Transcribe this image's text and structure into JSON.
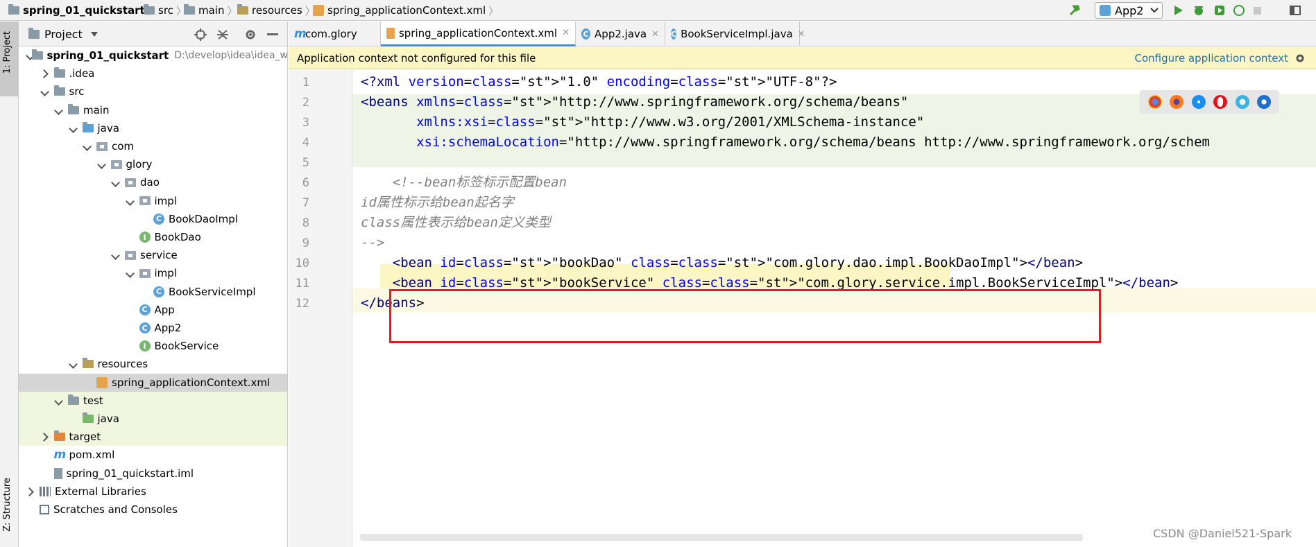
{
  "nav": {
    "breadcrumbs": [
      "spring_01_quickstart",
      "src",
      "main",
      "resources",
      "spring_applicationContext.xml"
    ],
    "run_config": "App2"
  },
  "side": {
    "project_tab": "1: Project",
    "structure_tab": "Z: Structure"
  },
  "project_panel": {
    "title": "Project"
  },
  "tree": [
    {
      "label": "spring_01_quickstart",
      "suffix": "D:\\develop\\idea\\idea_w",
      "icon": "module-folder-icon",
      "arrow": "d",
      "depth": 0
    },
    {
      "label": ".idea",
      "icon": "folder-icon",
      "arrow": "r",
      "depth": 1
    },
    {
      "label": "src",
      "icon": "folder-icon",
      "arrow": "d",
      "depth": 1
    },
    {
      "label": "main",
      "icon": "folder-icon",
      "arrow": "d",
      "depth": 2
    },
    {
      "label": "java",
      "icon": "source-folder-icon",
      "arrow": "d",
      "depth": 3
    },
    {
      "label": "com",
      "icon": "package-icon",
      "arrow": "d",
      "depth": 4
    },
    {
      "label": "glory",
      "icon": "package-icon",
      "arrow": "d",
      "depth": 5
    },
    {
      "label": "dao",
      "icon": "package-icon",
      "arrow": "d",
      "depth": 6
    },
    {
      "label": "impl",
      "icon": "package-icon",
      "arrow": "d",
      "depth": 7
    },
    {
      "label": "BookDaoImpl",
      "icon": "class-icon",
      "arrow": "n",
      "depth": 8
    },
    {
      "label": "BookDao",
      "icon": "interface-icon",
      "arrow": "n",
      "depth": 7
    },
    {
      "label": "service",
      "icon": "package-icon",
      "arrow": "d",
      "depth": 6
    },
    {
      "label": "impl",
      "icon": "package-icon",
      "arrow": "d",
      "depth": 7
    },
    {
      "label": "BookServiceImpl",
      "icon": "class-icon",
      "arrow": "n",
      "depth": 8
    },
    {
      "label": "App",
      "icon": "runnable-class-icon",
      "arrow": "n",
      "depth": 7
    },
    {
      "label": "App2",
      "icon": "runnable-class-icon",
      "arrow": "n",
      "depth": 7
    },
    {
      "label": "BookService",
      "icon": "interface-icon",
      "arrow": "n",
      "depth": 7
    },
    {
      "label": "resources",
      "icon": "resources-folder-icon",
      "arrow": "d",
      "depth": 3
    },
    {
      "label": "spring_applicationContext.xml",
      "icon": "spring-xml-icon",
      "arrow": "n",
      "depth": 4,
      "selected": true
    },
    {
      "label": "test",
      "icon": "folder-icon",
      "arrow": "d",
      "depth": 2
    },
    {
      "label": "java",
      "icon": "test-folder-icon",
      "arrow": "n",
      "depth": 3
    },
    {
      "label": "target",
      "icon": "excluded-folder-icon",
      "arrow": "r",
      "depth": 1
    },
    {
      "label": "pom.xml",
      "icon": "maven-icon",
      "arrow": "n",
      "depth": 1
    },
    {
      "label": "spring_01_quickstart.iml",
      "icon": "iml-file-icon",
      "arrow": "n",
      "depth": 1
    },
    {
      "label": "External Libraries",
      "icon": "libraries-icon",
      "arrow": "r",
      "depth": 0
    },
    {
      "label": "Scratches and Consoles",
      "icon": "scratches-icon",
      "arrow": "n",
      "depth": 0
    }
  ],
  "tabs": [
    {
      "label": "com.glory",
      "icon": "maven-icon"
    },
    {
      "label": "spring_applicationContext.xml",
      "icon": "spring-xml-icon",
      "active": true
    },
    {
      "label": "App2.java",
      "icon": "class-icon"
    },
    {
      "label": "BookServiceImpl.java",
      "icon": "class-icon"
    }
  ],
  "banner": {
    "message": "Application context not configured for this file",
    "link": "Configure application context"
  },
  "editor": {
    "line_numbers": [
      "1",
      "2",
      "3",
      "4",
      "5",
      "6",
      "7",
      "8",
      "9",
      "10",
      "11",
      "12"
    ],
    "lines": [
      "<?xml version=\"1.0\" encoding=\"UTF-8\"?>",
      "<beans xmlns=\"http://www.springframework.org/schema/beans\"",
      "       xmlns:xsi=\"http://www.w3.org/2001/XMLSchema-instance\"",
      "       xsi:schemaLocation=\"http://www.springframework.org/schema/beans http://www.springframework.org/schem",
      "",
      "    <!--bean标签标示配置bean",
      "id属性标示给bean起名字",
      "class属性表示给bean定义类型",
      "-->",
      "    <bean id=\"bookDao\" class=\"com.glory.dao.impl.BookDaoImpl\"></bean>",
      "    <bean id=\"bookService\" class=\"com.glory.service.impl.BookServiceImpl\"></bean>",
      "</beans>"
    ]
  },
  "watermark": "CSDN @Daniel521-Spark",
  "colors": {
    "accent": "#4a88c7",
    "banner_bg": "#fbf6c4",
    "highlight_box": "#e02020"
  }
}
